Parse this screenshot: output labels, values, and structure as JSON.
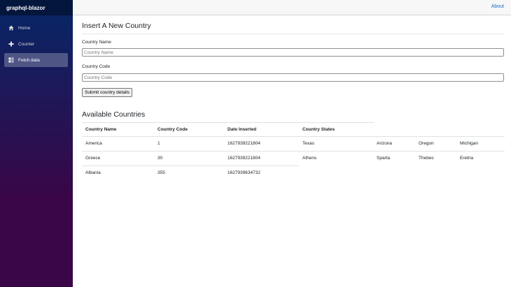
{
  "app": {
    "brand": "graphql-blazor"
  },
  "nav": [
    {
      "label": "Home",
      "icon": "home-icon"
    },
    {
      "label": "Counter",
      "icon": "plus-icon"
    },
    {
      "label": "Fetch data",
      "icon": "list-icon",
      "active": true
    }
  ],
  "topbar": {
    "about": "About"
  },
  "form": {
    "title": "Insert A New Country",
    "name_label": "Country Name",
    "name_placeholder": "Country Name",
    "code_label": "Country Code",
    "code_placeholder": "Country Code",
    "submit": "Submit country details"
  },
  "table": {
    "title": "Available Countries",
    "headers": [
      "Country Name",
      "Country Code",
      "Date Inserted",
      "Country States"
    ],
    "rows": [
      {
        "name": "America",
        "code": "1",
        "date": "1627939221804",
        "states": [
          "Texas",
          "Arizona",
          "Oregon",
          "Michigan"
        ]
      },
      {
        "name": "Greece",
        "code": "30",
        "date": "1627939221804",
        "states": [
          "Athens",
          "Sparta",
          "Thebes",
          "Eretria"
        ]
      },
      {
        "name": "Albania",
        "code": "355",
        "date": "1627939634732",
        "states": []
      }
    ]
  },
  "colors": {
    "accent": "#1b6ec2",
    "sidebar_top": "#052767",
    "sidebar_bottom": "#3a0647"
  }
}
